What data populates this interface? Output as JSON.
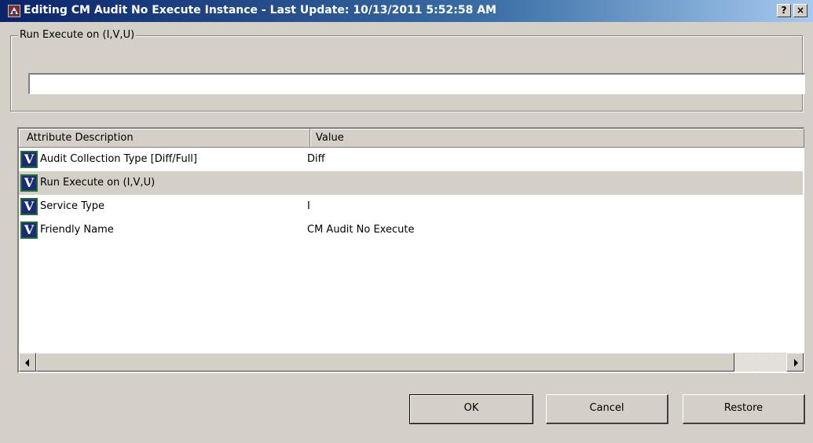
{
  "window": {
    "title": "Editing CM Audit No Execute Instance - Last Update: 10/13/2011 5:52:58 AM",
    "help_label": "?",
    "close_label": "×"
  },
  "run_group": {
    "legend": "Run Execute on (I,V,U)",
    "input_value": "",
    "input_placeholder": ""
  },
  "table": {
    "columns": [
      "Attribute Description",
      "Value"
    ],
    "icon_letter": "V",
    "rows": [
      {
        "description": "Audit Collection Type [Diff/Full]",
        "value": "Diff"
      },
      {
        "description": "Run Execute on (I,V,U)",
        "value": ""
      },
      {
        "description": "Service Type",
        "value": "I"
      },
      {
        "description": "Friendly Name",
        "value": "CM Audit No Execute"
      }
    ],
    "selected_row": 1
  },
  "buttons": {
    "ok": "OK",
    "cancel": "Cancel",
    "restore": "Restore"
  },
  "colors": {
    "titlebar_start": "#0a246a",
    "dialog_bg": "#d4d0c8",
    "icon_bg": "#1c2a7a"
  }
}
